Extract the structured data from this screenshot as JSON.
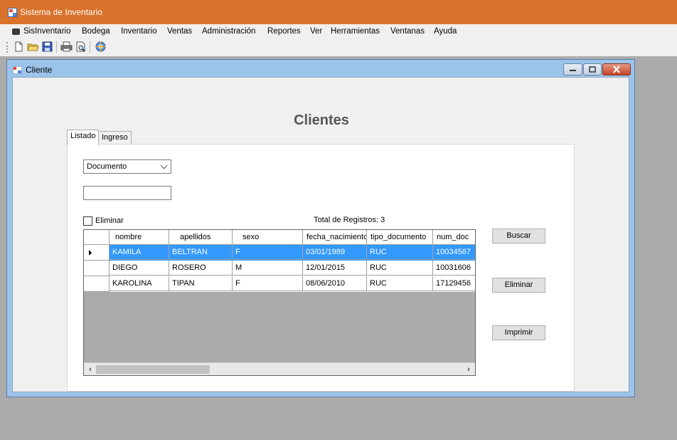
{
  "app": {
    "title": "Sistema de Inventario"
  },
  "menu": [
    "SisInventario",
    "Bodega",
    "Inventario",
    "Ventas",
    "Administración",
    "Reportes",
    "Ver",
    "Herramientas",
    "Ventanas",
    "Ayuda"
  ],
  "toolbar": {
    "icons": [
      "new-icon",
      "open-icon",
      "save-icon",
      "print-icon",
      "print-preview-icon",
      "help-icon"
    ]
  },
  "child_window": {
    "title": "Cliente",
    "heading": "Clientes"
  },
  "tabs": [
    "Listado",
    "Ingreso"
  ],
  "filter": {
    "combo_value": "Documento",
    "search_value": "",
    "checkbox_label": "Eliminar",
    "checkbox_checked": false
  },
  "total_label": "Total de Registros: 3",
  "grid": {
    "columns": [
      "nombre",
      "apellidos",
      "sexo",
      "fecha_nacimiento",
      "tipo_documento",
      "num_doc"
    ],
    "rows": [
      [
        "KAMILA",
        "BELTRAN",
        "F",
        "03/01/1989",
        "RUC",
        "10034567"
      ],
      [
        "DIEGO",
        "ROSERO",
        "M",
        "12/01/2015",
        "RUC",
        "10031606"
      ],
      [
        "KAROLINA",
        "TIPAN",
        "F",
        "08/06/2010",
        "RUC",
        "17129456"
      ]
    ],
    "selected_row": 0
  },
  "buttons": {
    "buscar": "Buscar",
    "eliminar": "Eliminar",
    "imprimir": "Imprimir"
  },
  "colors": {
    "titlebar": "#d9722b",
    "selection": "#3399ff",
    "window_frame": "#9cc4ea"
  }
}
